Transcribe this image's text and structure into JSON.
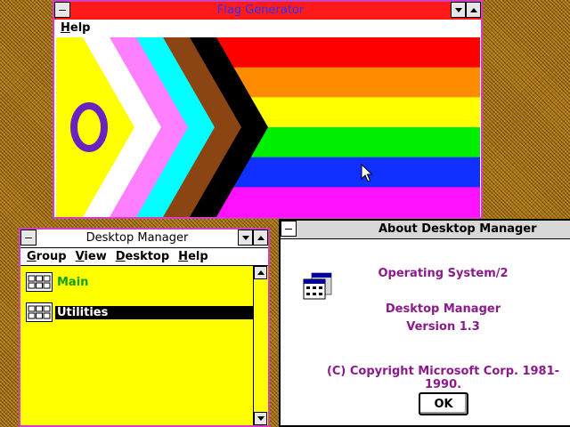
{
  "flag_window": {
    "title": "Flag Generator",
    "menu": [
      "Help"
    ],
    "title_color": "#3030ff",
    "titlebar_color": "#ff1a1a",
    "stripe_colors": [
      "#ff0000",
      "#ff8c00",
      "#ffff00",
      "#00ee00",
      "#1030ff",
      "#ff10ff"
    ],
    "chevron_colors": [
      "#000000",
      "#8b4513",
      "#00ffff",
      "#ff80ff",
      "#ffffff",
      "#ffff00"
    ],
    "ring_color": "#6a22c0"
  },
  "desktop_manager": {
    "title": "Desktop Manager",
    "menu": [
      "Group",
      "View",
      "Desktop",
      "Help"
    ],
    "groups": [
      {
        "label": "Main",
        "selected": false,
        "color": "#10a010"
      },
      {
        "label": "Utilities",
        "selected": true,
        "color": "#ffffff"
      }
    ]
  },
  "about": {
    "title": "About Desktop Manager",
    "os_name": "Operating System/2",
    "app_name": "Desktop Manager",
    "version": "Version 1.3",
    "copyright": "(C) Copyright Microsoft Corp. 1981-1990.",
    "ok_label": "OK"
  }
}
